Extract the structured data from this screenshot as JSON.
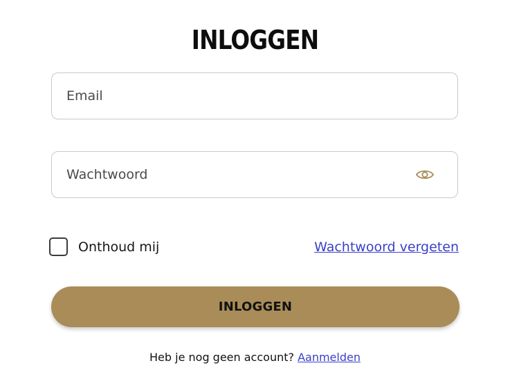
{
  "page": {
    "title": "INLOGGEN"
  },
  "form": {
    "email_placeholder": "Email",
    "email_value": "",
    "password_placeholder": "Wachtwoord",
    "password_value": "",
    "password_toggle_icon": "eye-icon",
    "remember_label": "Onthoud mij",
    "remember_checked": false,
    "forgot_link": "Wachtwoord vergeten",
    "submit_label": "INLOGGEN"
  },
  "signup": {
    "prompt": "Heb je nog geen account?",
    "link": "Aanmelden"
  },
  "colors": {
    "accent": "#a98c57",
    "link": "#3a3fc8",
    "eye_icon": "#a98c57"
  }
}
